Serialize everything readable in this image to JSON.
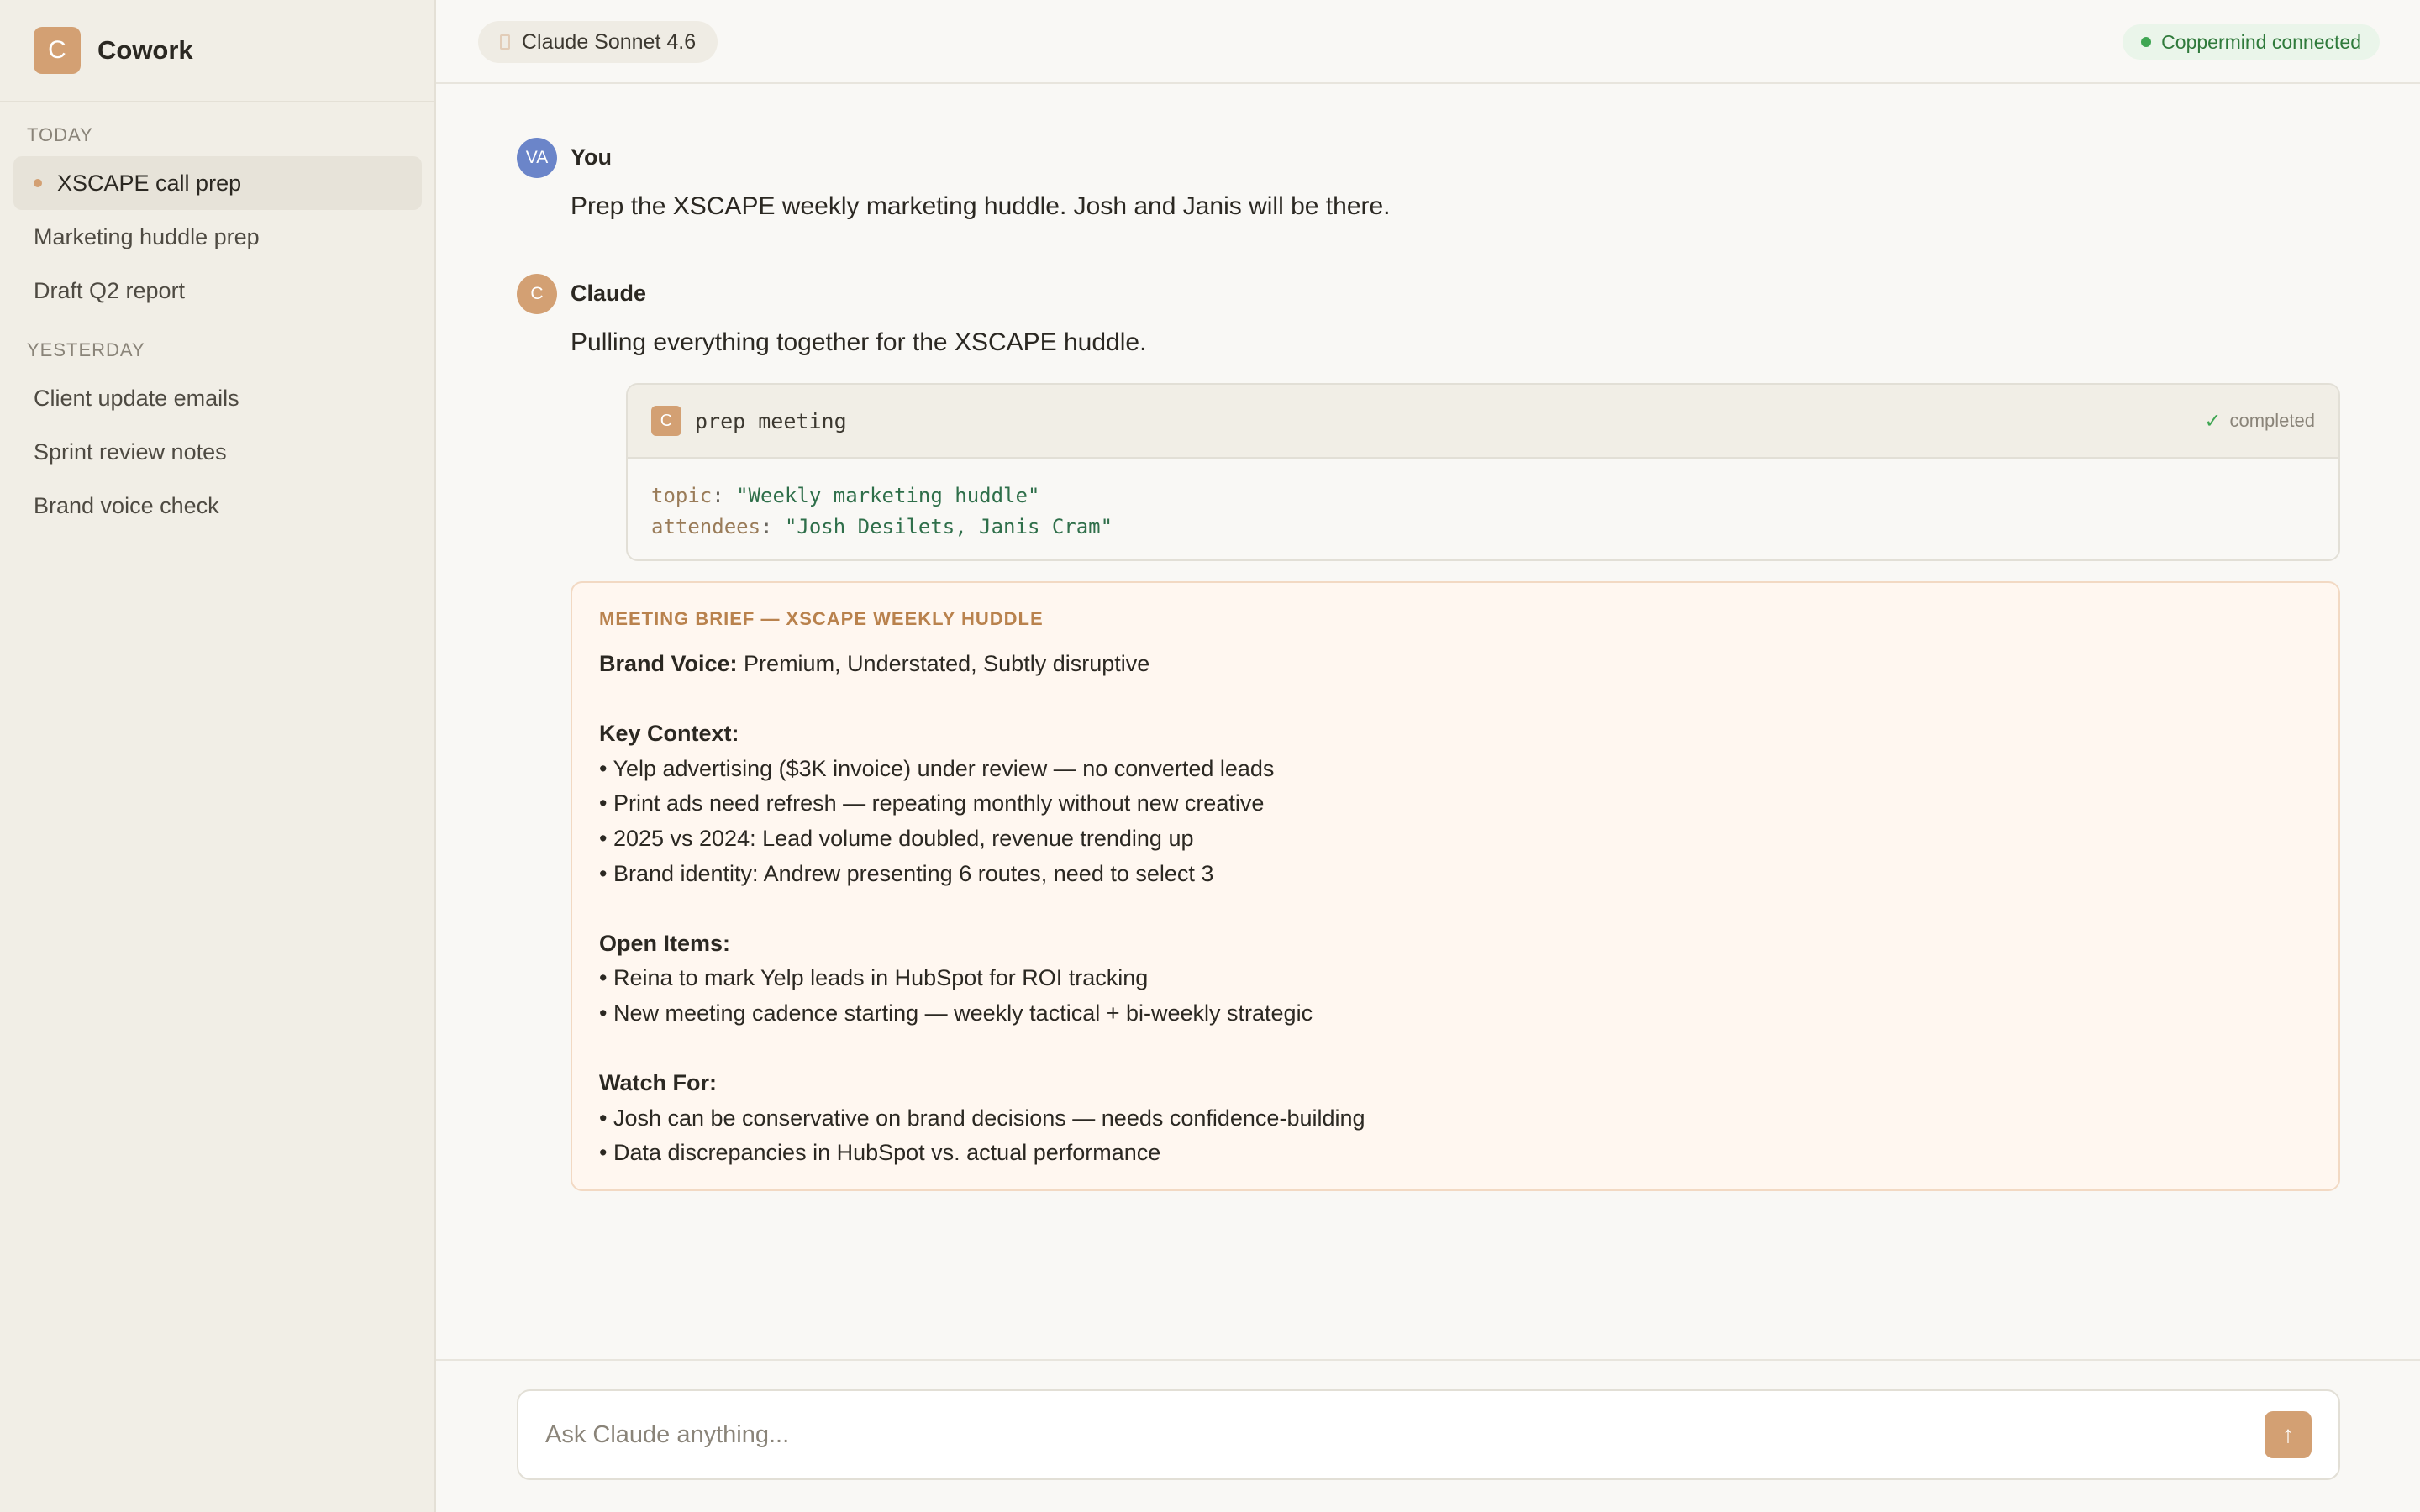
{
  "app": {
    "name": "Cowork",
    "logo_letter": "C",
    "accent": "#d3a073"
  },
  "sidebar": {
    "today_label": "TODAY",
    "yesterday_label": "YESTERDAY",
    "today_items": [
      {
        "label": "XSCAPE call prep",
        "active": true
      },
      {
        "label": "Marketing huddle prep"
      },
      {
        "label": "Draft Q2 report"
      }
    ],
    "yesterday_items": [
      {
        "label": "Client update emails"
      },
      {
        "label": "Sprint review notes"
      },
      {
        "label": "Brand voice check"
      }
    ]
  },
  "header": {
    "model_label": "Claude Sonnet 4.6",
    "connection_status": "Coppermind connected",
    "connection_color": "#3fa653"
  },
  "conversation": {
    "user": {
      "initials": "VA",
      "name": "You",
      "avatar_color": "#6b85c9",
      "text": "Prep the XSCAPE weekly marketing huddle. Josh and Janis will be there."
    },
    "assistant": {
      "initial": "C",
      "name": "Claude",
      "avatar_color": "#d3a073",
      "text": "Pulling everything together for the XSCAPE huddle."
    },
    "tool_call": {
      "badge": "C",
      "name": "prep_meeting",
      "status": "completed",
      "params": [
        {
          "key": "topic",
          "value": "\"Weekly marketing huddle\""
        },
        {
          "key": "attendees",
          "value": "\"Josh Desilets, Janis Cram\""
        }
      ]
    },
    "brief": {
      "title": "MEETING BRIEF — XSCAPE WEEKLY HUDDLE",
      "brand_voice_label": "Brand Voice:",
      "brand_voice_value": "Premium, Understated, Subtly disruptive",
      "key_context_label": "Key Context:",
      "key_context": [
        "• Yelp advertising ($3K invoice) under review — no converted leads",
        "• Print ads need refresh — repeating monthly without new creative",
        "• 2025 vs 2024: Lead volume doubled, revenue trending up",
        "• Brand identity: Andrew presenting 6 routes, need to select 3"
      ],
      "open_items_label": "Open Items:",
      "open_items": [
        "• Reina to mark Yelp leads in HubSpot for ROI tracking",
        "• New meeting cadence starting — weekly tactical + bi-weekly strategic"
      ],
      "watch_for_label": "Watch For:",
      "watch_for": [
        "• Josh can be conservative on brand decisions — needs confidence-building",
        "• Data discrepancies in HubSpot vs. actual performance"
      ]
    }
  },
  "composer": {
    "placeholder": "Ask Claude anything...",
    "value": ""
  }
}
